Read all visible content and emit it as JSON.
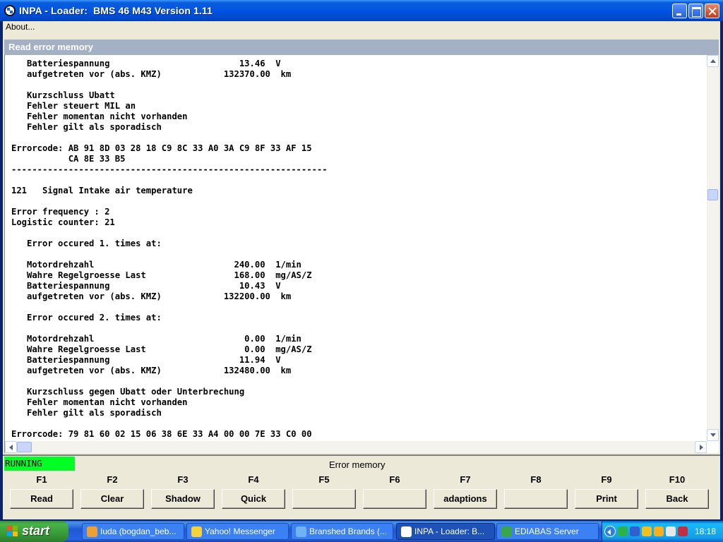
{
  "window": {
    "title": "INPA - Loader:  BMS 46 M43 Version 1.11"
  },
  "menu": {
    "about": "About..."
  },
  "panel": {
    "header": "Read error memory"
  },
  "text_lines": [
    "   Batteriespannung                         13.46  V",
    "   aufgetreten vor (abs. KMZ)            132370.00  km",
    "",
    "   Kurzschluss Ubatt",
    "   Fehler steuert MIL an",
    "   Fehler momentan nicht vorhanden",
    "   Fehler gilt als sporadisch",
    "",
    "Errorcode: AB 91 8D 03 28 18 C9 8C 33 A0 3A C9 8F 33 AF 15",
    "           CA 8E 33 B5",
    "-------------------------------------------------------------",
    "",
    "121   Signal Intake air temperature",
    "",
    "Error frequency : 2",
    "Logistic counter: 21",
    "",
    "   Error occured 1. times at:",
    "",
    "   Motordrehzahl                           240.00  1/min",
    "   Wahre Regelgroesse Last                 168.00  mg/AS/Z",
    "   Batteriespannung                         10.43  V",
    "   aufgetreten vor (abs. KMZ)            132200.00  km",
    "",
    "   Error occured 2. times at:",
    "",
    "   Motordrehzahl                             0.00  1/min",
    "   Wahre Regelgroesse Last                   0.00  mg/AS/Z",
    "   Batteriespannung                         11.94  V",
    "   aufgetreten vor (abs. KMZ)            132480.00  km",
    "",
    "   Kurzschluss gegen Ubatt oder Unterbrechung",
    "   Fehler momentan nicht vorhanden",
    "   Fehler gilt als sporadisch",
    "",
    "Errorcode: 79 81 60 02 15 06 38 6E 33 A4 00 00 7E 33 C0 00"
  ],
  "status": {
    "text": "RUNNING",
    "color": "#00ff22"
  },
  "screen_title": "Error memory",
  "function_keys": [
    {
      "key": "F1",
      "label": "Read"
    },
    {
      "key": "F2",
      "label": "Clear"
    },
    {
      "key": "F3",
      "label": "Shadow"
    },
    {
      "key": "F4",
      "label": "Quick"
    },
    {
      "key": "F5",
      "label": ""
    },
    {
      "key": "F6",
      "label": ""
    },
    {
      "key": "F7",
      "label": "adaptions"
    },
    {
      "key": "F8",
      "label": ""
    },
    {
      "key": "F9",
      "label": "Print"
    },
    {
      "key": "F10",
      "label": "Back"
    }
  ],
  "taskbar": {
    "start_label": "start",
    "tasks": [
      {
        "label": "Iuda (bogdan_beb...",
        "icon": "browser-icon",
        "color": "#f0a030"
      },
      {
        "label": "Yahoo! Messenger",
        "icon": "messenger-icon",
        "color": "#f5d23a"
      },
      {
        "label": "Branshed Brands (...",
        "icon": "browser-icon",
        "color": "#6fb3f0"
      },
      {
        "label": "INPA - Loader:  B...",
        "icon": "inpa-icon",
        "color": "#ffffff"
      },
      {
        "label": "EDIABAS Server",
        "icon": "ediabas-icon",
        "color": "#3aa64a"
      }
    ],
    "clock": "18:18",
    "tray_icons": [
      {
        "icon": "network-icon",
        "color": "#2bb34a"
      },
      {
        "icon": "usb-icon",
        "color": "#3060d0"
      },
      {
        "icon": "mail-icon",
        "color": "#f0c020"
      },
      {
        "icon": "messenger-icon",
        "color": "#f5b020"
      },
      {
        "icon": "wireless-icon",
        "color": "#e8e8e8"
      },
      {
        "icon": "volume-icon",
        "color": "#c03040"
      }
    ]
  }
}
